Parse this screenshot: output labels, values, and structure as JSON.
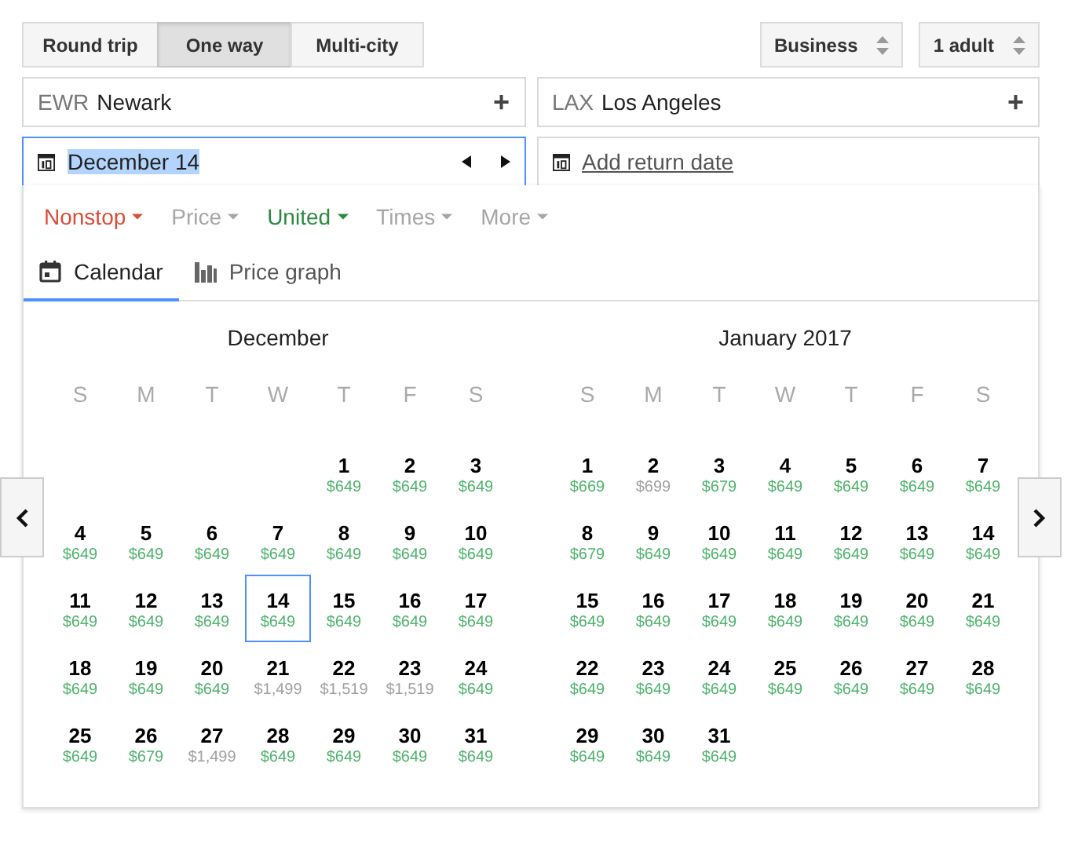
{
  "trip_types": [
    {
      "label": "Round trip",
      "selected": false
    },
    {
      "label": "One way",
      "selected": true
    },
    {
      "label": "Multi-city",
      "selected": false
    }
  ],
  "cabin": {
    "value": "Business"
  },
  "passengers": {
    "value": "1 adult"
  },
  "origin": {
    "code": "EWR",
    "city": "Newark",
    "action": "+"
  },
  "destination": {
    "code": "LAX",
    "city": "Los Angeles",
    "action": "+"
  },
  "departure_date": {
    "value": "December 14"
  },
  "return_date": {
    "link": "Add return date"
  },
  "filters": [
    {
      "label": "Nonstop",
      "color": "#dd4b39"
    },
    {
      "label": "Price",
      "color": "#a6a6a6"
    },
    {
      "label": "United",
      "color": "#2b8a3e"
    },
    {
      "label": "Times",
      "color": "#a6a6a6"
    },
    {
      "label": "More",
      "color": "#a6a6a6"
    }
  ],
  "views": [
    {
      "label": "Calendar",
      "kind": "calendar",
      "selected": true
    },
    {
      "label": "Price graph",
      "kind": "graph",
      "selected": false
    }
  ],
  "months": [
    {
      "title": "December",
      "weekdays": [
        "S",
        "M",
        "T",
        "W",
        "T",
        "F",
        "S"
      ],
      "days": [
        {
          "kind": "empty"
        },
        {
          "kind": "empty"
        },
        {
          "kind": "empty"
        },
        {
          "kind": "empty"
        },
        {
          "kind": "day",
          "day": "1",
          "price": "$649",
          "color": "#4db36b",
          "selected": false
        },
        {
          "kind": "day",
          "day": "2",
          "price": "$649",
          "color": "#4db36b",
          "selected": false
        },
        {
          "kind": "day",
          "day": "3",
          "price": "$649",
          "color": "#4db36b",
          "selected": false
        },
        {
          "kind": "day",
          "day": "4",
          "price": "$649",
          "color": "#4db36b",
          "selected": false
        },
        {
          "kind": "day",
          "day": "5",
          "price": "$649",
          "color": "#4db36b",
          "selected": false
        },
        {
          "kind": "day",
          "day": "6",
          "price": "$649",
          "color": "#4db36b",
          "selected": false
        },
        {
          "kind": "day",
          "day": "7",
          "price": "$649",
          "color": "#4db36b",
          "selected": false
        },
        {
          "kind": "day",
          "day": "8",
          "price": "$649",
          "color": "#4db36b",
          "selected": false
        },
        {
          "kind": "day",
          "day": "9",
          "price": "$649",
          "color": "#4db36b",
          "selected": false
        },
        {
          "kind": "day",
          "day": "10",
          "price": "$649",
          "color": "#4db36b",
          "selected": false
        },
        {
          "kind": "day",
          "day": "11",
          "price": "$649",
          "color": "#4db36b",
          "selected": false
        },
        {
          "kind": "day",
          "day": "12",
          "price": "$649",
          "color": "#4db36b",
          "selected": false
        },
        {
          "kind": "day",
          "day": "13",
          "price": "$649",
          "color": "#4db36b",
          "selected": false
        },
        {
          "kind": "day",
          "day": "14",
          "price": "$649",
          "color": "#4db36b",
          "selected": true
        },
        {
          "kind": "day",
          "day": "15",
          "price": "$649",
          "color": "#4db36b",
          "selected": false
        },
        {
          "kind": "day",
          "day": "16",
          "price": "$649",
          "color": "#4db36b",
          "selected": false
        },
        {
          "kind": "day",
          "day": "17",
          "price": "$649",
          "color": "#4db36b",
          "selected": false
        },
        {
          "kind": "day",
          "day": "18",
          "price": "$649",
          "color": "#4db36b",
          "selected": false
        },
        {
          "kind": "day",
          "day": "19",
          "price": "$649",
          "color": "#4db36b",
          "selected": false
        },
        {
          "kind": "day",
          "day": "20",
          "price": "$649",
          "color": "#4db36b",
          "selected": false
        },
        {
          "kind": "day",
          "day": "21",
          "price": "$1,499",
          "color": "#a0a0a0",
          "selected": false
        },
        {
          "kind": "day",
          "day": "22",
          "price": "$1,519",
          "color": "#a0a0a0",
          "selected": false
        },
        {
          "kind": "day",
          "day": "23",
          "price": "$1,519",
          "color": "#a0a0a0",
          "selected": false
        },
        {
          "kind": "day",
          "day": "24",
          "price": "$649",
          "color": "#4db36b",
          "selected": false
        },
        {
          "kind": "day",
          "day": "25",
          "price": "$649",
          "color": "#4db36b",
          "selected": false
        },
        {
          "kind": "day",
          "day": "26",
          "price": "$679",
          "color": "#4db36b",
          "selected": false
        },
        {
          "kind": "day",
          "day": "27",
          "price": "$1,499",
          "color": "#a0a0a0",
          "selected": false
        },
        {
          "kind": "day",
          "day": "28",
          "price": "$649",
          "color": "#4db36b",
          "selected": false
        },
        {
          "kind": "day",
          "day": "29",
          "price": "$649",
          "color": "#4db36b",
          "selected": false
        },
        {
          "kind": "day",
          "day": "30",
          "price": "$649",
          "color": "#4db36b",
          "selected": false
        },
        {
          "kind": "day",
          "day": "31",
          "price": "$649",
          "color": "#4db36b",
          "selected": false
        }
      ]
    },
    {
      "title": "January 2017",
      "weekdays": [
        "S",
        "M",
        "T",
        "W",
        "T",
        "F",
        "S"
      ],
      "days": [
        {
          "kind": "day",
          "day": "1",
          "price": "$669",
          "color": "#4db36b",
          "selected": false
        },
        {
          "kind": "day",
          "day": "2",
          "price": "$699",
          "color": "#a0a0a0",
          "selected": false
        },
        {
          "kind": "day",
          "day": "3",
          "price": "$679",
          "color": "#4db36b",
          "selected": false
        },
        {
          "kind": "day",
          "day": "4",
          "price": "$649",
          "color": "#4db36b",
          "selected": false
        },
        {
          "kind": "day",
          "day": "5",
          "price": "$649",
          "color": "#4db36b",
          "selected": false
        },
        {
          "kind": "day",
          "day": "6",
          "price": "$649",
          "color": "#4db36b",
          "selected": false
        },
        {
          "kind": "day",
          "day": "7",
          "price": "$649",
          "color": "#4db36b",
          "selected": false
        },
        {
          "kind": "day",
          "day": "8",
          "price": "$679",
          "color": "#4db36b",
          "selected": false
        },
        {
          "kind": "day",
          "day": "9",
          "price": "$649",
          "color": "#4db36b",
          "selected": false
        },
        {
          "kind": "day",
          "day": "10",
          "price": "$649",
          "color": "#4db36b",
          "selected": false
        },
        {
          "kind": "day",
          "day": "11",
          "price": "$649",
          "color": "#4db36b",
          "selected": false
        },
        {
          "kind": "day",
          "day": "12",
          "price": "$649",
          "color": "#4db36b",
          "selected": false
        },
        {
          "kind": "day",
          "day": "13",
          "price": "$649",
          "color": "#4db36b",
          "selected": false
        },
        {
          "kind": "day",
          "day": "14",
          "price": "$649",
          "color": "#4db36b",
          "selected": false
        },
        {
          "kind": "day",
          "day": "15",
          "price": "$649",
          "color": "#4db36b",
          "selected": false
        },
        {
          "kind": "day",
          "day": "16",
          "price": "$649",
          "color": "#4db36b",
          "selected": false
        },
        {
          "kind": "day",
          "day": "17",
          "price": "$649",
          "color": "#4db36b",
          "selected": false
        },
        {
          "kind": "day",
          "day": "18",
          "price": "$649",
          "color": "#4db36b",
          "selected": false
        },
        {
          "kind": "day",
          "day": "19",
          "price": "$649",
          "color": "#4db36b",
          "selected": false
        },
        {
          "kind": "day",
          "day": "20",
          "price": "$649",
          "color": "#4db36b",
          "selected": false
        },
        {
          "kind": "day",
          "day": "21",
          "price": "$649",
          "color": "#4db36b",
          "selected": false
        },
        {
          "kind": "day",
          "day": "22",
          "price": "$649",
          "color": "#4db36b",
          "selected": false
        },
        {
          "kind": "day",
          "day": "23",
          "price": "$649",
          "color": "#4db36b",
          "selected": false
        },
        {
          "kind": "day",
          "day": "24",
          "price": "$649",
          "color": "#4db36b",
          "selected": false
        },
        {
          "kind": "day",
          "day": "25",
          "price": "$649",
          "color": "#4db36b",
          "selected": false
        },
        {
          "kind": "day",
          "day": "26",
          "price": "$649",
          "color": "#4db36b",
          "selected": false
        },
        {
          "kind": "day",
          "day": "27",
          "price": "$649",
          "color": "#4db36b",
          "selected": false
        },
        {
          "kind": "day",
          "day": "28",
          "price": "$649",
          "color": "#4db36b",
          "selected": false
        },
        {
          "kind": "day",
          "day": "29",
          "price": "$649",
          "color": "#4db36b",
          "selected": false
        },
        {
          "kind": "day",
          "day": "30",
          "price": "$649",
          "color": "#4db36b",
          "selected": false
        },
        {
          "kind": "day",
          "day": "31",
          "price": "$649",
          "color": "#4db36b",
          "selected": false
        }
      ]
    }
  ]
}
